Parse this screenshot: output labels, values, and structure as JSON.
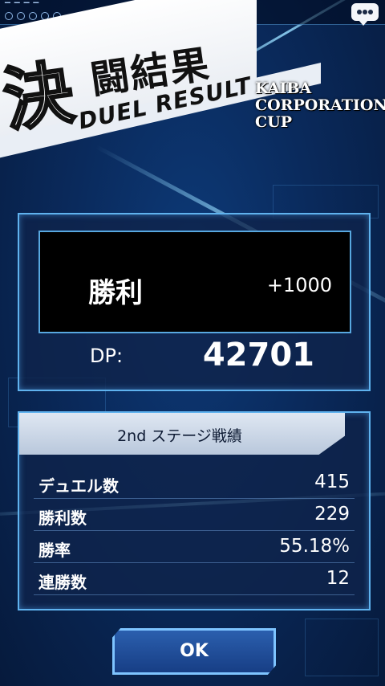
{
  "title": {
    "kanji_big": "決",
    "kanji_rest": "闘結果",
    "english": "DUEL RESULT"
  },
  "event": {
    "line1": "KAIBA",
    "line2": "CORPORATION",
    "line3": "CUP"
  },
  "result": {
    "outcome": "勝利",
    "dp_change": "+1000",
    "dp_label": "DP:",
    "dp_total": "42701"
  },
  "stats": {
    "header": "2nd ステージ戦績",
    "rows": [
      {
        "label": "デュエル数",
        "value": "415"
      },
      {
        "label": "勝利数",
        "value": "229"
      },
      {
        "label": "勝率",
        "value": "55.18%"
      },
      {
        "label": "連勝数",
        "value": "12"
      }
    ]
  },
  "ok_button": {
    "label": "OK"
  },
  "icons": {
    "chat": "chat-bubble-icon"
  },
  "colors": {
    "panel_border": "#5fb2ee",
    "background": "#0a2a5c",
    "button": "#1f4c98"
  }
}
